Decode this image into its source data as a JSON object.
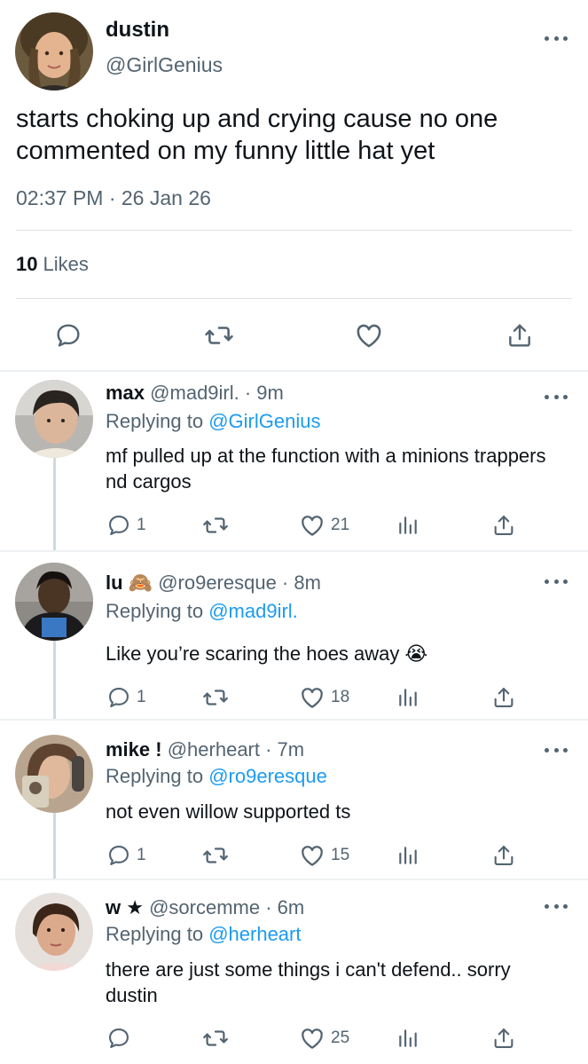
{
  "main_tweet": {
    "author_name": "dustin",
    "author_handle": "@GirlGenius",
    "text": "starts choking up and crying cause no one commented on my funny little hat yet",
    "timestamp": "02:37 PM · 26 Jan 26",
    "likes_count": "10",
    "likes_label": "Likes"
  },
  "replies": [
    {
      "name": "max",
      "handle": "@mad9irl. · 9m",
      "replying_label": "Replying to",
      "replying_to": "@GirlGenius",
      "text": "mf pulled up at the function with a minions trappers nd cargos",
      "reply_count": "1",
      "like_count": "21"
    },
    {
      "name": "lu 🙈",
      "handle": "@ro9eresque · 8m",
      "replying_label": "Replying to",
      "replying_to": "@mad9irl.",
      "text": "Like you’re scaring the hoes away 😭",
      "reply_count": "1",
      "like_count": "18"
    },
    {
      "name": "mike !",
      "handle": "@herheart · 7m",
      "replying_label": "Replying to",
      "replying_to": "@ro9eresque",
      "text": "not even willow supported ts",
      "reply_count": "1",
      "like_count": "15"
    },
    {
      "name": "w ★",
      "handle": "@sorcemme · 6m",
      "replying_label": "Replying to",
      "replying_to": "@herheart",
      "text": "there are just some things i can't defend.. sorry dustin",
      "reply_count": "",
      "like_count": "25"
    }
  ],
  "icons": {
    "reply": "speech-bubble-icon",
    "retweet": "retweet-icon",
    "like": "heart-icon",
    "views": "bar-chart-icon",
    "share": "share-icon",
    "more": "ellipsis-icon"
  },
  "colors": {
    "link": "#1d9bf0",
    "secondary_text": "#536471",
    "primary_text": "#0f1419"
  }
}
